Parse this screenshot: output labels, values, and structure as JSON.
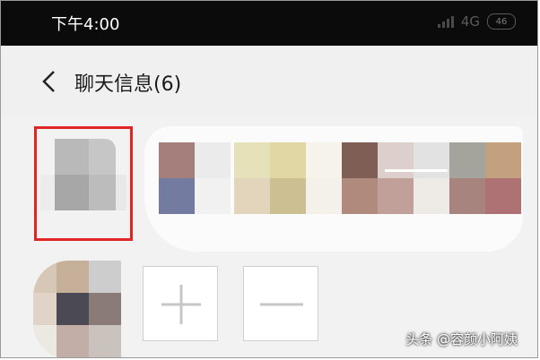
{
  "status_bar": {
    "time": "下午4:00",
    "network": "4G",
    "battery": "46"
  },
  "header": {
    "back_icon": "chevron-left-icon",
    "title": "聊天信息(6)"
  },
  "members": {
    "selected_member_highlight": "#e02525",
    "add_member_icon": "plus-icon",
    "remove_member_icon": "minus-icon"
  },
  "watermark": "头条 @容颜小阿姨"
}
